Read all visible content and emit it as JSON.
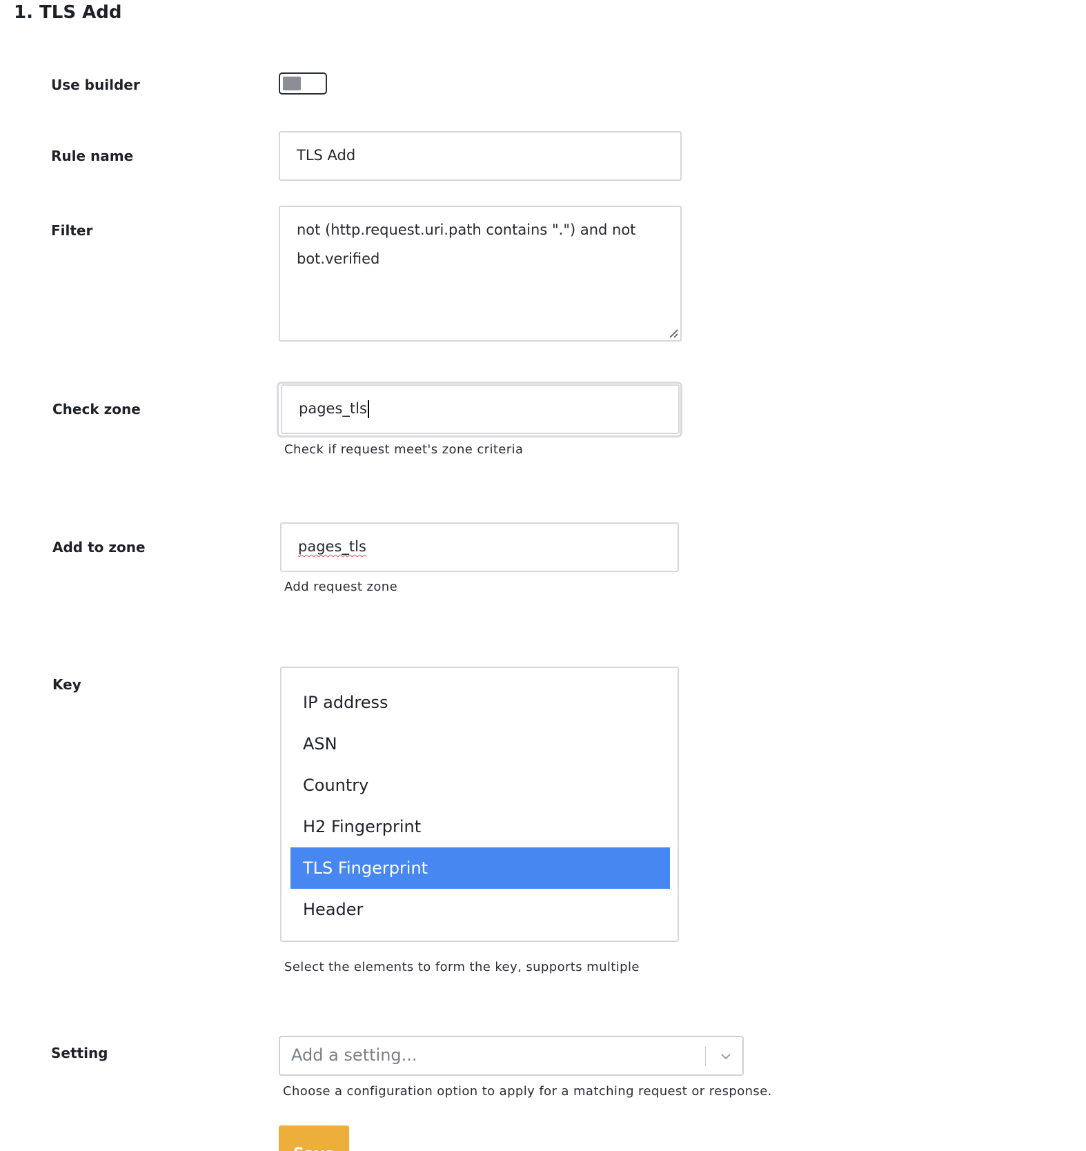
{
  "heading": "1.  TLS Add",
  "fields": {
    "use_builder": {
      "label": "Use builder",
      "enabled": false
    },
    "rule_name": {
      "label": "Rule name",
      "value": "TLS Add"
    },
    "filter": {
      "label": "Filter",
      "line1": "not (http.request.uri.path contains \".\") and not",
      "line2": "bot.verified"
    },
    "check_zone": {
      "label": "Check zone",
      "value": "pages_tls",
      "help": "Check if request meet's zone criteria"
    },
    "add_to_zone": {
      "label": "Add to zone",
      "value": "pages_tls",
      "help": "Add request zone"
    },
    "key": {
      "label": "Key",
      "options": [
        "IP address",
        "ASN",
        "Country",
        "H2 Fingerprint",
        "TLS Fingerprint",
        "Header"
      ],
      "selected": "TLS Fingerprint",
      "help": "Select the elements to form the key, supports multiple"
    },
    "setting": {
      "label": "Setting",
      "placeholder": "Add a setting...",
      "help": "Choose a configuration option to apply for a matching request or response."
    }
  },
  "save_label": "Save",
  "colors": {
    "selected_option": "#4787f2",
    "save_button": "#eeae3c"
  }
}
